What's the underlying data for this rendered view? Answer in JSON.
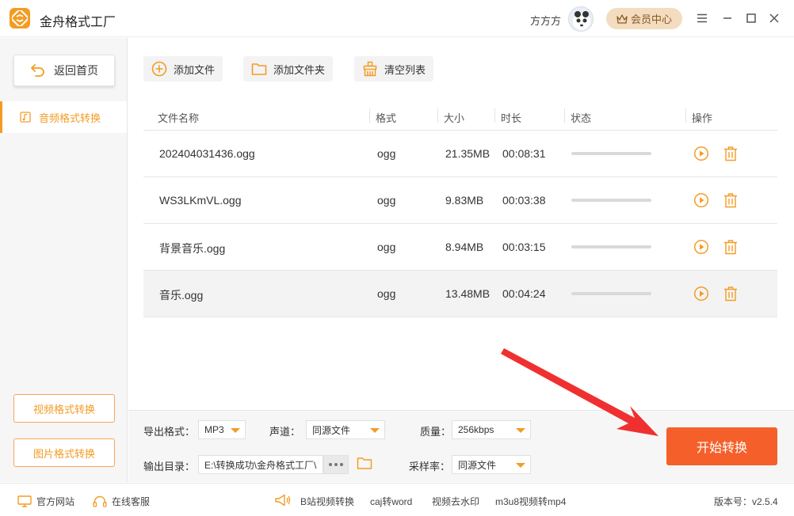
{
  "app": {
    "title": "金舟格式工厂"
  },
  "user": {
    "name": "方方方"
  },
  "header": {
    "vip_label": "会员中心"
  },
  "sidebar": {
    "back_label": "返回首页",
    "active_item": "音频格式转换",
    "bottom_buttons": [
      "视频格式转换",
      "图片格式转换"
    ]
  },
  "toolbar": {
    "add_file": "添加文件",
    "add_folder": "添加文件夹",
    "clear_list": "清空列表"
  },
  "table": {
    "headers": [
      "文件名称",
      "格式",
      "大小",
      "时长",
      "状态",
      "操作"
    ],
    "rows": [
      {
        "name": "202404031436.ogg",
        "format": "ogg",
        "size": "21.35MB",
        "duration": "00:08:31",
        "progress": 0
      },
      {
        "name": "WS3LKmVL.ogg",
        "format": "ogg",
        "size": "9.83MB",
        "duration": "00:03:38",
        "progress": 0
      },
      {
        "name": "背景音乐.ogg",
        "format": "ogg",
        "size": "8.94MB",
        "duration": "00:03:15",
        "progress": 0
      },
      {
        "name": "音乐.ogg",
        "format": "ogg",
        "size": "13.48MB",
        "duration": "00:04:24",
        "progress": 0
      }
    ]
  },
  "settings": {
    "export_format_label": "导出格式：",
    "export_format_value": "MP3",
    "channel_label": "声道：",
    "channel_value": "同源文件",
    "quality_label": "质量：",
    "quality_value": "256kbps",
    "output_dir_label": "输出目录：",
    "output_dir_value": "E:\\转换成功\\金舟格式工厂\\",
    "sample_rate_label": "采样率：",
    "sample_rate_value": "同源文件",
    "start_label": "开始转换"
  },
  "footer": {
    "website": "官方网站",
    "support": "在线客服",
    "links": [
      "B站视频转换",
      "caj转word",
      "视频去水印",
      "m3u8视频转mp4"
    ],
    "version": "版本号：v2.5.4"
  },
  "colors": {
    "accent": "#f39c24",
    "start_button": "#f5602a",
    "annotation_arrow": "#f03030"
  },
  "icons": [
    "logo-icon",
    "back-arrow-icon",
    "music-file-icon",
    "add-circle-icon",
    "folder-icon",
    "broom-icon",
    "play-circle-icon",
    "trash-icon",
    "crown-icon",
    "menu-icon",
    "minimize-icon",
    "maximize-icon",
    "close-icon",
    "monitor-icon",
    "headset-icon",
    "megaphone-icon"
  ]
}
